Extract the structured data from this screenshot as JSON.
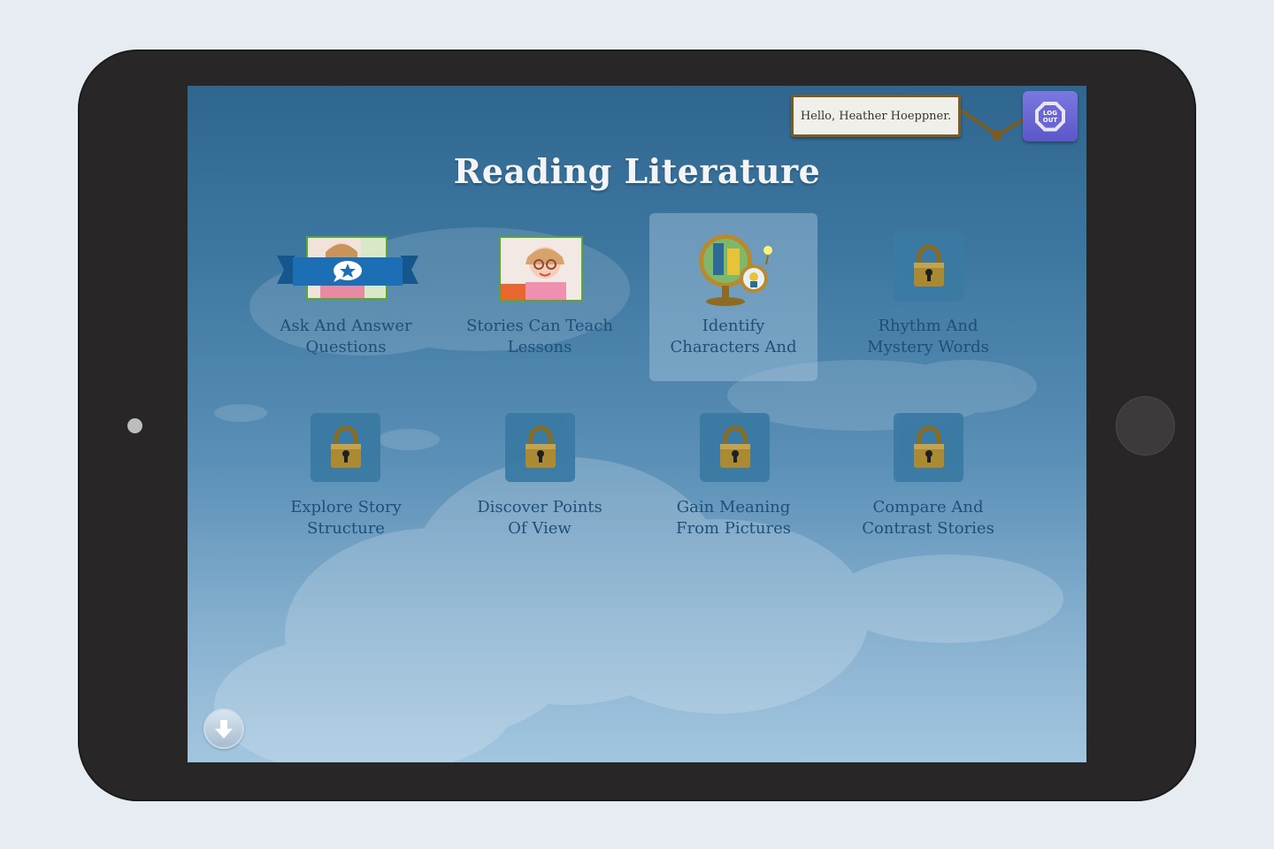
{
  "screen": {
    "title": "Reading Literature"
  },
  "header": {
    "greeting": "Hello, Heather Hoeppner.",
    "logout_line1": "LOG",
    "logout_line2": "OUT"
  },
  "lessons": [
    {
      "label_line1": "Ask And Answer",
      "label_line2": "Questions",
      "status": "unlocked",
      "icon": "ribbon-thumbnail-icon"
    },
    {
      "label_line1": "Stories Can Teach",
      "label_line2": "Lessons",
      "status": "unlocked",
      "icon": "girl-glasses-thumbnail-icon"
    },
    {
      "label_line1": "Identify",
      "label_line2": "Characters And",
      "status": "selected",
      "icon": "magnifying-glass-icon"
    },
    {
      "label_line1": "Rhythm And",
      "label_line2": "Mystery Words",
      "status": "locked",
      "icon": "padlock-icon"
    },
    {
      "label_line1": "Explore Story",
      "label_line2": "Structure",
      "status": "locked",
      "icon": "padlock-icon"
    },
    {
      "label_line1": "Discover Points",
      "label_line2": "Of View",
      "status": "locked",
      "icon": "padlock-icon"
    },
    {
      "label_line1": "Gain Meaning",
      "label_line2": "From Pictures",
      "status": "locked",
      "icon": "padlock-icon"
    },
    {
      "label_line1": "Compare And",
      "label_line2": "Contrast Stories",
      "status": "locked",
      "icon": "padlock-icon"
    }
  ],
  "footer": {
    "scroll_icon": "arrow-down-icon"
  },
  "colors": {
    "tablet_bezel": "#282626",
    "logout_button": "#6a66d6",
    "label_text": "#1f4f78",
    "ribbon": "#1d6fb5"
  }
}
